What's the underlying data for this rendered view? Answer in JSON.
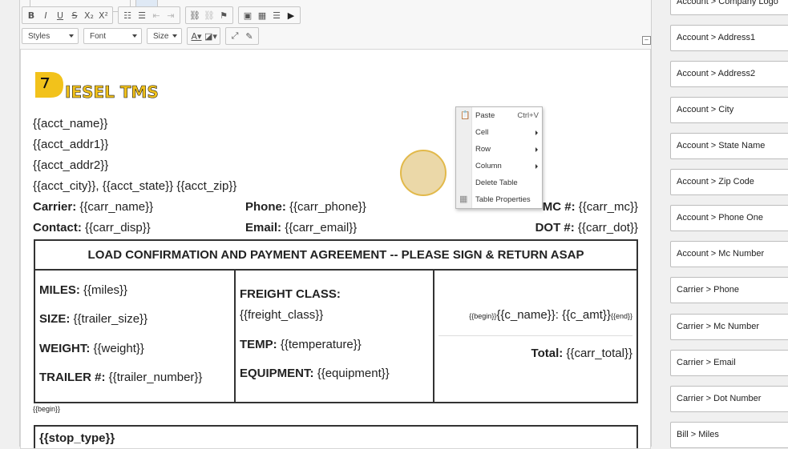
{
  "toolbar": {
    "styles": "Styles",
    "font": "Font",
    "size": "Size"
  },
  "doc": {
    "acct_name": "{{acct_name}}",
    "acct_addr1": "{{acct_addr1}}",
    "acct_addr2": "{{acct_addr2}}",
    "acct_city_state_zip": "{{acct_city}}, {{acct_state}} {{acct_zip}}",
    "carrier_label": "Carrier:",
    "carrier_value": "{{carr_name}}",
    "phone_label": "Phone:",
    "phone_value": "{{carr_phone}}",
    "mc_label": "MC #:",
    "mc_value": "{{carr_mc}}",
    "contact_label": "Contact:",
    "contact_value": "{{carr_disp}}",
    "email_label": "Email:",
    "email_value": "{{carr_email}}",
    "dot_label": "DOT #:",
    "dot_value": "{{carr_dot}}",
    "table_title": "LOAD CONFIRMATION AND PAYMENT AGREEMENT -- PLEASE SIGN & RETURN ASAP",
    "miles_label": "MILES:",
    "miles_value": "{{miles}}",
    "size_label": "SIZE:",
    "size_value": "{{trailer_size}}",
    "weight_label": "WEIGHT:",
    "weight_value": "{{weight}}",
    "trailer_label": "TRAILER #:",
    "trailer_value": "{{trailer_number}}",
    "freight_label": "FREIGHT CLASS:",
    "freight_value": "{{freight_class}}",
    "temp_label": "TEMP:",
    "temp_value": "{{temperature}}",
    "equip_label": "EQUIPMENT:",
    "equip_value": "{{equipment}}",
    "begin_small": "{{begin}}",
    "charge_value": "{{c_name}}: {{c_amt}}",
    "end_small": "{{end}}",
    "total_label": "Total:",
    "total_value": "{{carr_total}}",
    "begin_below": "{{begin}}",
    "stop_type": "{{stop_type}}"
  },
  "context_menu": {
    "items": [
      {
        "label": "Paste",
        "shortcut": "Ctrl+V"
      },
      {
        "label": "Cell"
      },
      {
        "label": "Row"
      },
      {
        "label": "Column"
      },
      {
        "label": "Delete Table"
      },
      {
        "label": "Table Properties"
      }
    ]
  },
  "sidebar": {
    "items": [
      "Account > Company Logo",
      "Account > Address1",
      "Account > Address2",
      "Account > City",
      "Account > State Name",
      "Account > Zip Code",
      "Account > Phone One",
      "Account > Mc Number",
      "Carrier > Phone",
      "Carrier > Mc Number",
      "Carrier > Email",
      "Carrier > Dot Number",
      "Bill > Miles"
    ]
  },
  "colors": {
    "logo_yellow": "#f2c21b",
    "cursor_fill": "#e9d49e",
    "cursor_ring": "#e2b94a"
  }
}
